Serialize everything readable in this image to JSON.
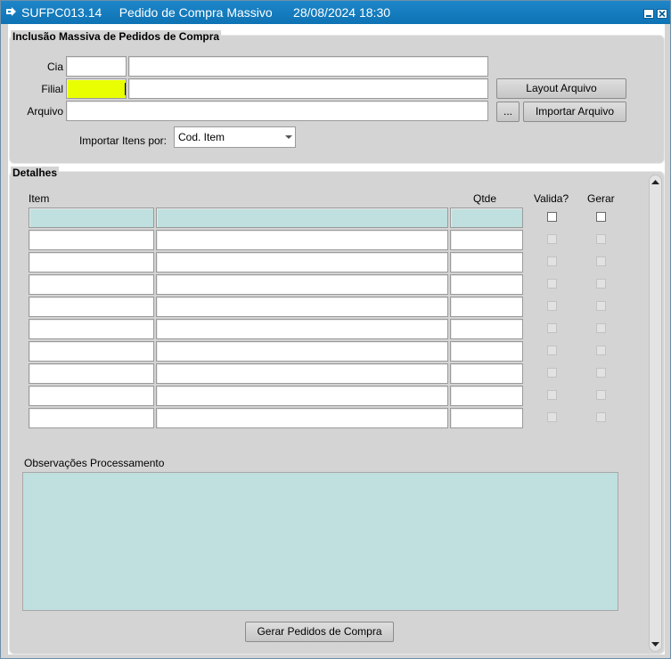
{
  "window": {
    "title": "SUFPC013.14     Pedido de Compra Massivo      28/08/2024 18:30"
  },
  "header_panel": {
    "legend": "Inclusão Massiva de Pedidos de Compra",
    "cia_label": "Cia",
    "filial_label": "Filial",
    "arquivo_label": "Arquivo",
    "layout_button": "Layout Arquivo",
    "browse_button": "...",
    "importar_button": "Importar Arquivo",
    "importar_por_label": "Importar Itens por:",
    "importar_por_value": "Cod. Item"
  },
  "details_panel": {
    "legend": "Detalhes",
    "columns": {
      "item": "Item",
      "qtde": "Qtde",
      "valida": "Valida?",
      "gerar": "Gerar"
    },
    "row_count": 10,
    "observacoes_label": "Observações Processamento",
    "gerar_button": "Gerar Pedidos de Compra"
  },
  "colors": {
    "title_bar": "#0e73b5",
    "focused_field": "#e9ff00",
    "current_row": "#bfe0df",
    "panel_bg": "#d4d4d4"
  }
}
